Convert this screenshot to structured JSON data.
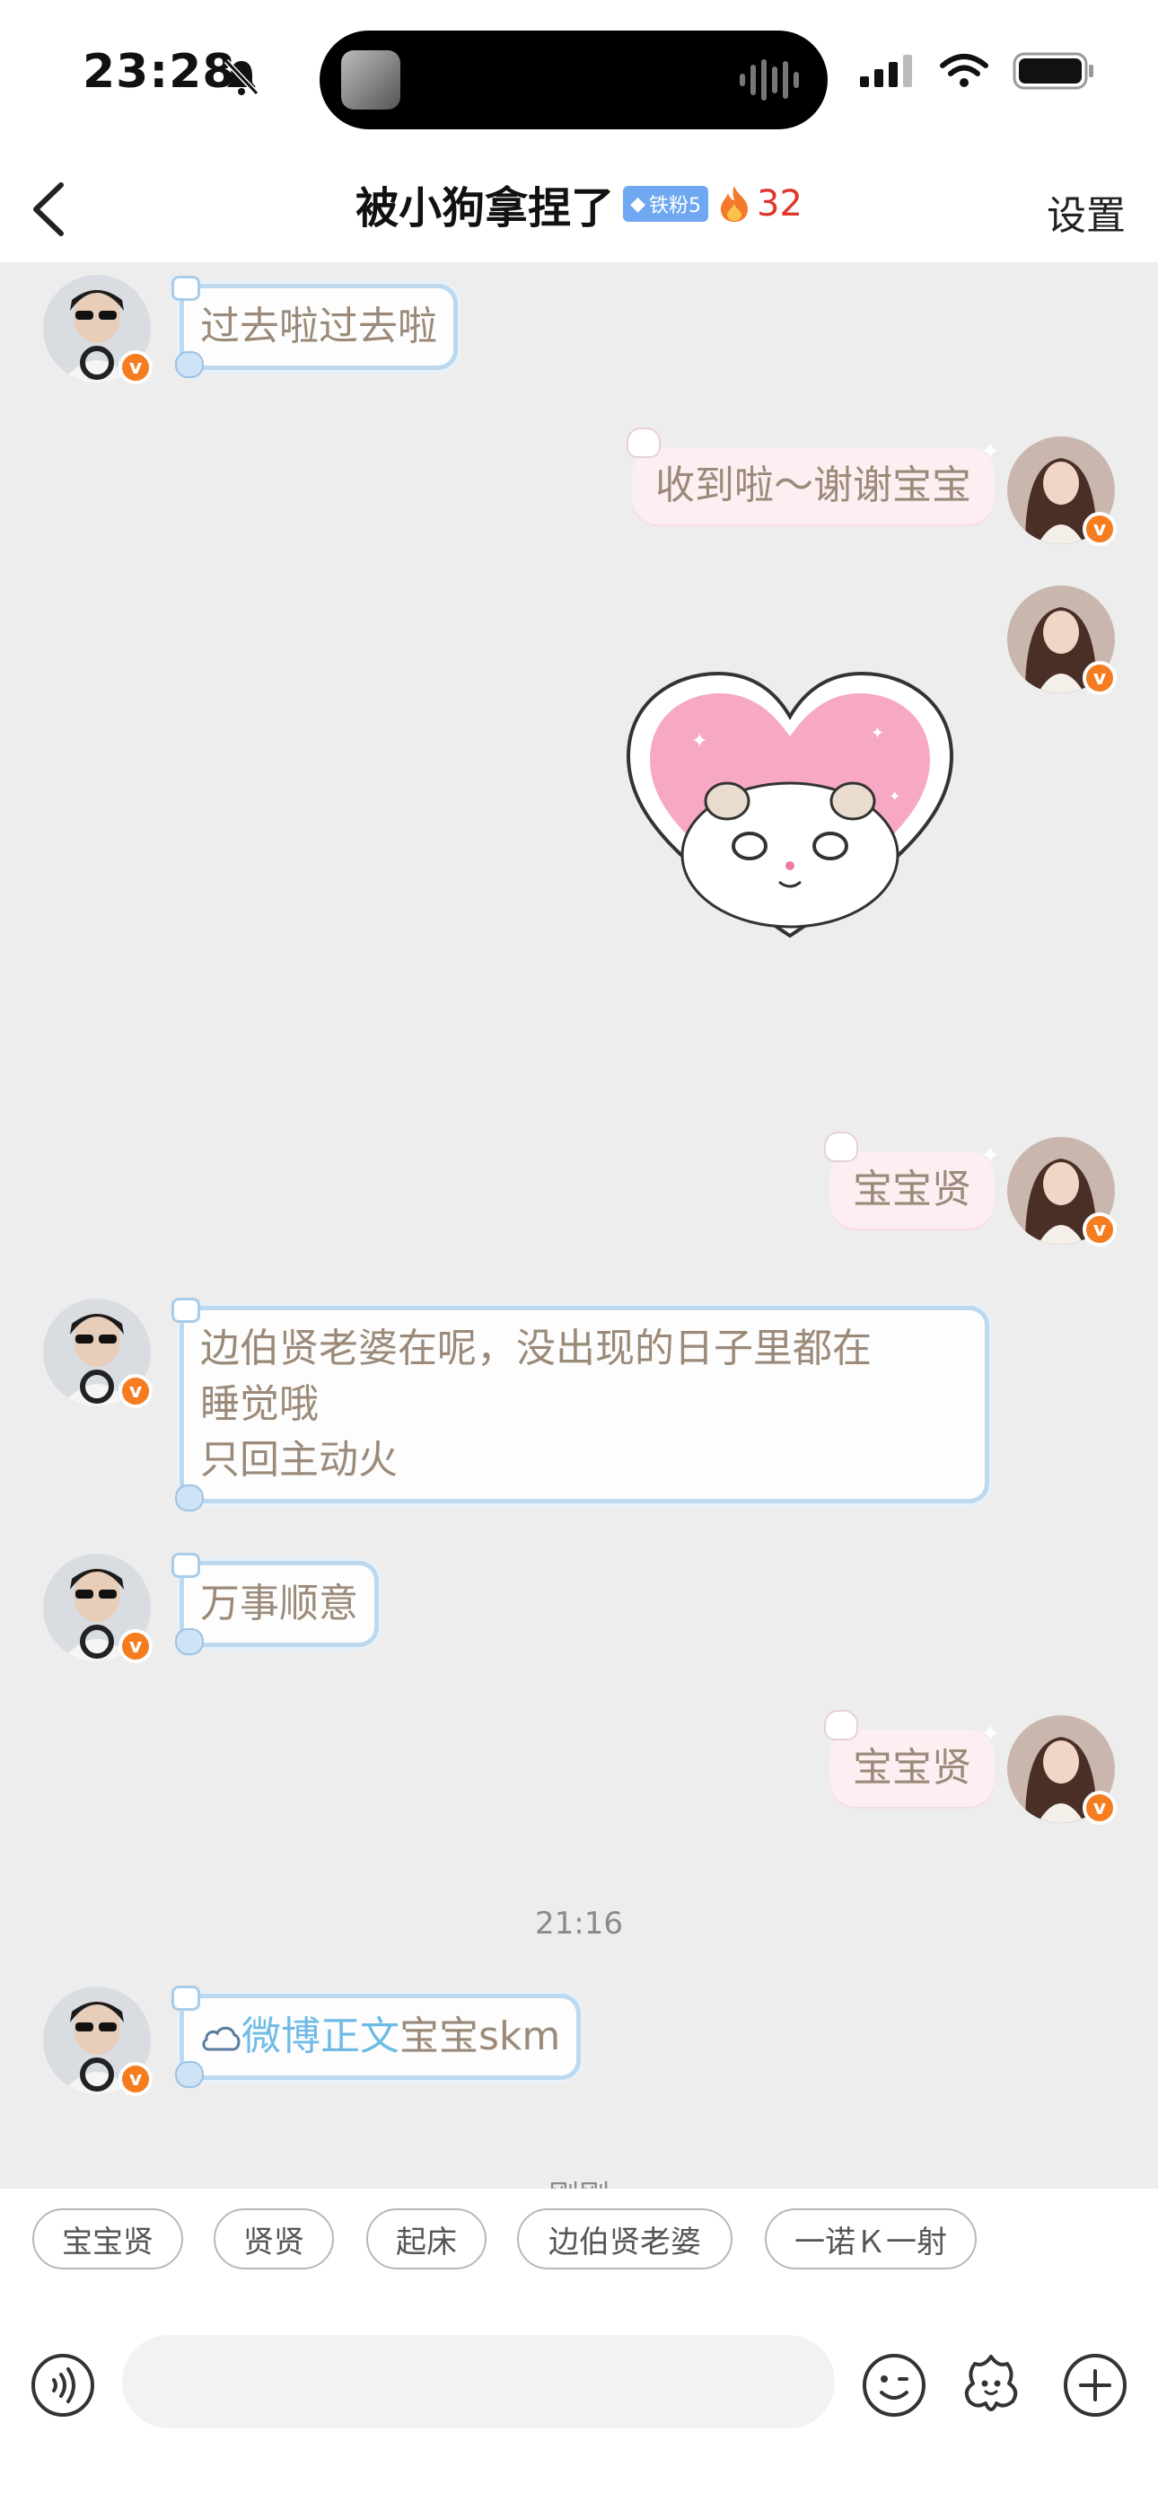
{
  "status": {
    "time": "23:28"
  },
  "nav": {
    "title": "被小狗拿捏了",
    "fan_badge": "铁粉5",
    "fire_count": "32",
    "settings": "设置"
  },
  "messages": [
    {
      "side": "left",
      "text": "过去啦过去啦"
    },
    {
      "side": "right",
      "text": "收到啦～谢谢宝宝"
    },
    {
      "side": "right",
      "type": "sticker",
      "sticker": "hamster-heart-sticker"
    },
    {
      "side": "right",
      "text": "宝宝贤"
    },
    {
      "side": "left",
      "lines": [
        "边伯贤老婆在呢，没出现的日子里都在",
        "睡觉哦",
        "只回主动火"
      ]
    },
    {
      "side": "left",
      "text": "万事顺意"
    },
    {
      "side": "right",
      "text": "宝宝贤"
    },
    {
      "type": "timestamp",
      "text": "21:16"
    },
    {
      "side": "left",
      "link_text": "微博正文",
      "text": "宝宝skm"
    },
    {
      "type": "timestamp",
      "text": "刚刚"
    }
  ],
  "quick_replies": [
    "宝宝贤",
    "贤贤",
    "起床",
    "边伯贤老婆",
    "一诺Ｋ一射"
  ],
  "input": {
    "placeholder": ""
  },
  "colors": {
    "bubble_left_border": "#bcd9ef",
    "bubble_right_bg": "#fdeef2",
    "text": "#9b8a79",
    "link": "#6fbbe6",
    "badge": "#f57c1f"
  },
  "icons": [
    "bell-slash-icon",
    "signal-icon",
    "wifi-icon",
    "battery-icon",
    "back-chevron-icon",
    "fire-icon",
    "voice-icon",
    "emoji-icon",
    "flower-sticker-icon",
    "plus-icon"
  ]
}
